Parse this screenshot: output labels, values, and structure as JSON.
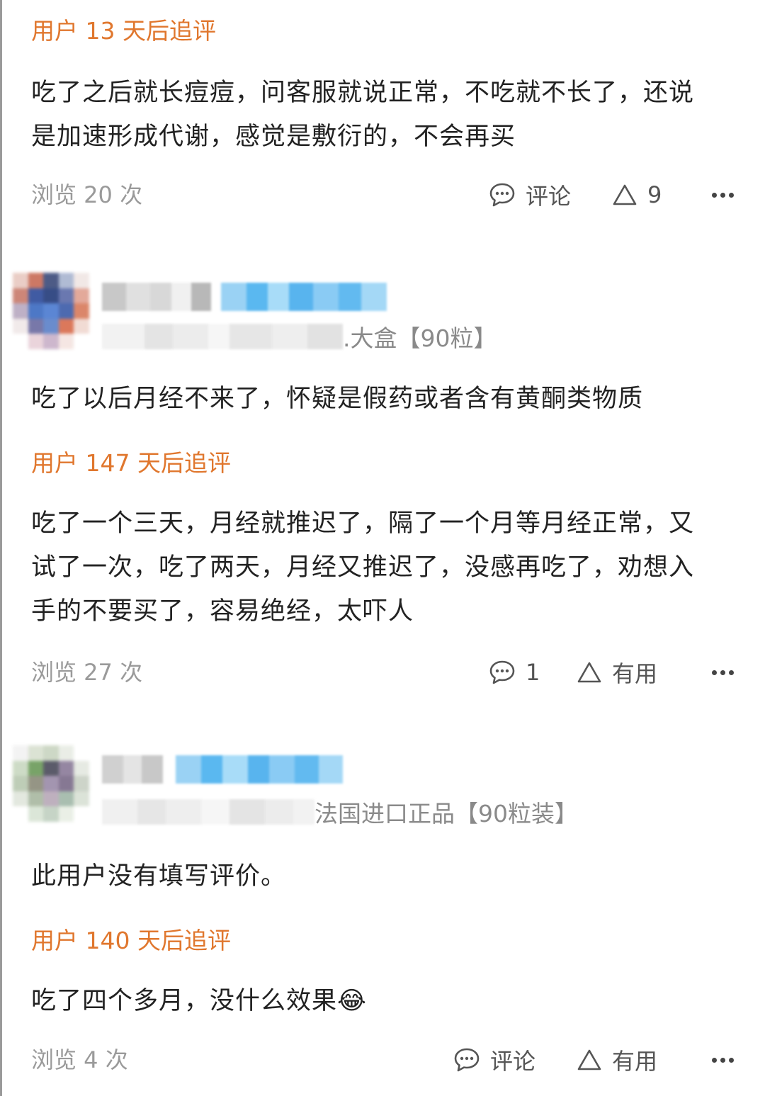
{
  "reviews": [
    {
      "followup_label": "用户 13 天后追评",
      "followup_text": "吃了之后就长痘痘，问客服就说正常，不吃就不长了，还说是加速形成代谢，感觉是敷衍的，不会再买",
      "views": "浏览 20 次",
      "comment_label": "评论",
      "useful_label": "9",
      "more_icon": "more-icon"
    },
    {
      "product_suffix": ".大盒【90粒】",
      "review_text": "吃了以后月经不来了，怀疑是假药或者含有黄酮类物质",
      "followup_label": "用户 147 天后追评",
      "followup_text": "吃了一个三天，月经就推迟了，隔了一个月等月经正常，又试了一次，吃了两天，月经又推迟了，没感再吃了，劝想入手的不要买了，容易绝经，太吓人",
      "views": "浏览 27 次",
      "comment_label": "1",
      "useful_label": "有用"
    },
    {
      "product_suffix": "法国进口正品【90粒装】",
      "review_text": "此用户没有填写评价。",
      "followup_label": "用户 140 天后追评",
      "followup_text": "吃了四个多月，没什么￼效果😂",
      "views": "浏览 4 次",
      "comment_label": "评论",
      "useful_label": "有用"
    }
  ],
  "colors": {
    "followup": "#e0772e",
    "muted": "#9a9a9a",
    "text": "#222222"
  }
}
